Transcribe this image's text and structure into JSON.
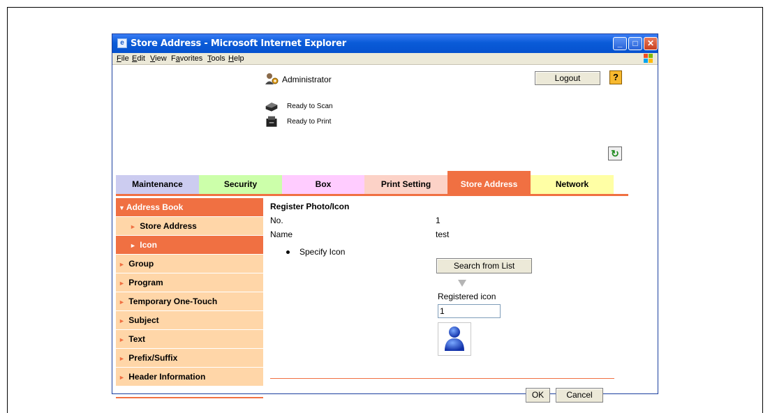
{
  "window": {
    "title": "Store Address - Microsoft Internet Explorer",
    "menu": [
      "File",
      "Edit",
      "View",
      "Favorites",
      "Tools",
      "Help"
    ],
    "menu_underline": [
      "F",
      "E",
      "V",
      "a",
      "T",
      "H"
    ]
  },
  "header": {
    "user": "Administrator",
    "logout_label": "Logout",
    "help_glyph": "?",
    "status": [
      {
        "label": "Ready to Scan",
        "icon": "scanner-icon"
      },
      {
        "label": "Ready to Print",
        "icon": "printer-icon"
      }
    ],
    "refresh_glyph": "↻"
  },
  "tabs": [
    {
      "label": "Maintenance",
      "color": "#ccccf0",
      "active": false
    },
    {
      "label": "Security",
      "color": "#ccffaa",
      "active": false
    },
    {
      "label": "Box",
      "color": "#ffccff",
      "active": false
    },
    {
      "label": "Print Setting",
      "color": "#fcd2c7",
      "active": false
    },
    {
      "label": "Store Address",
      "color": "#f07042",
      "active": true
    },
    {
      "label": "Network",
      "color": "#ffffa5",
      "active": false
    }
  ],
  "sidebar": {
    "items": [
      {
        "label": "Address Book",
        "level": 0,
        "state": "header",
        "arrow": "▼"
      },
      {
        "label": "Store Address",
        "level": 1,
        "state": "normal",
        "arrow": "►"
      },
      {
        "label": "Icon",
        "level": 1,
        "state": "active",
        "arrow": "►"
      },
      {
        "label": "Group",
        "level": 0,
        "state": "normal",
        "arrow": "►"
      },
      {
        "label": "Program",
        "level": 0,
        "state": "normal",
        "arrow": "►"
      },
      {
        "label": "Temporary One-Touch",
        "level": 0,
        "state": "normal",
        "arrow": "►"
      },
      {
        "label": "Subject",
        "level": 0,
        "state": "normal",
        "arrow": "►"
      },
      {
        "label": "Text",
        "level": 0,
        "state": "normal",
        "arrow": "►"
      },
      {
        "label": "Prefix/Suffix",
        "level": 0,
        "state": "normal",
        "arrow": "►"
      },
      {
        "label": "Header Information",
        "level": 0,
        "state": "normal",
        "arrow": "►"
      }
    ],
    "colors": {
      "header": "#f07042",
      "normal": "#ffd6a8",
      "active": "#f07042"
    }
  },
  "main": {
    "title": "Register Photo/Icon",
    "no_label": "No.",
    "no_value": "1",
    "name_label": "Name",
    "name_value": "test",
    "radio_label": "Specify Icon",
    "search_label": "Search from List",
    "registered_label": "Registered icon",
    "registered_value": "1",
    "ok_label": "OK",
    "cancel_label": "Cancel"
  }
}
